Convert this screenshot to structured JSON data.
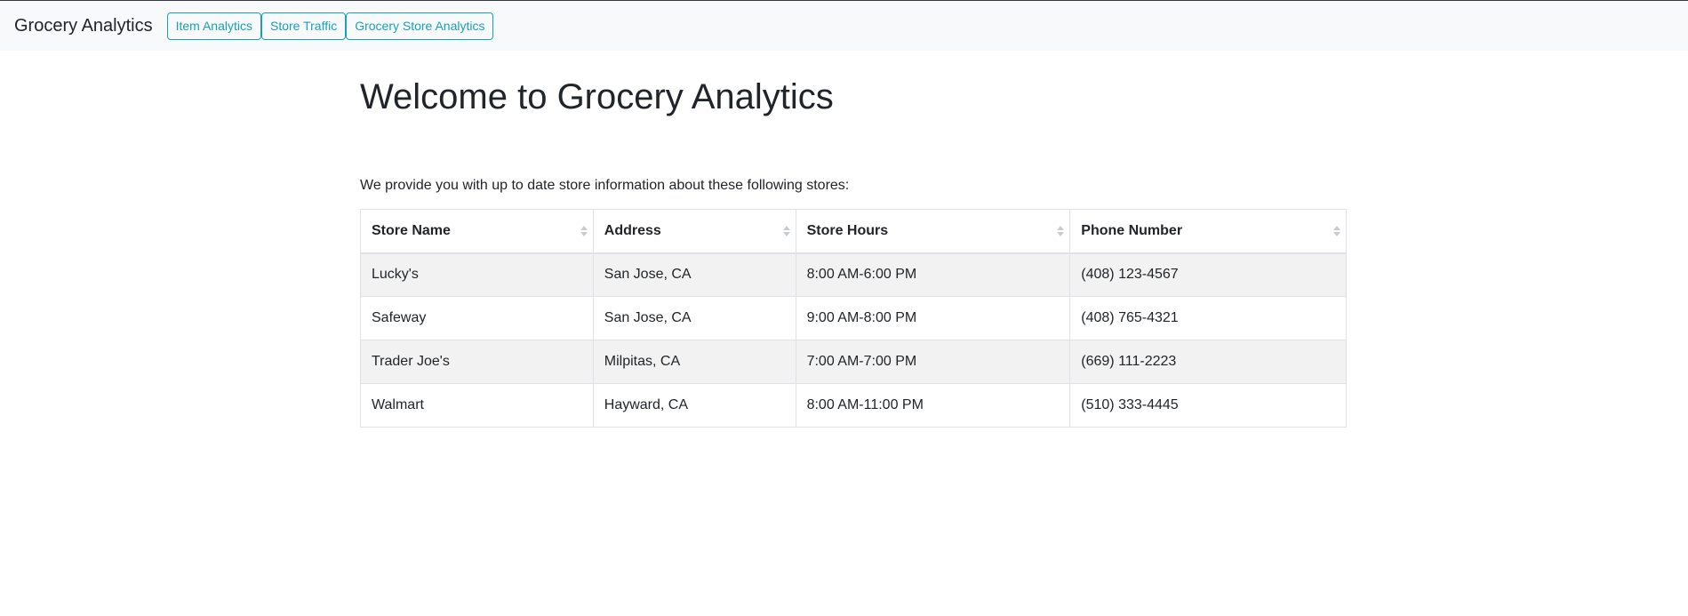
{
  "navbar": {
    "brand": "Grocery Analytics",
    "buttons": [
      {
        "label": "Item Analytics"
      },
      {
        "label": "Store Traffic"
      },
      {
        "label": "Grocery Store Analytics"
      }
    ]
  },
  "main": {
    "title": "Welcome to Grocery Analytics",
    "intro": "We provide you with up to date store information about these following stores:"
  },
  "table": {
    "headers": [
      "Store Name",
      "Address",
      "Store Hours",
      "Phone Number"
    ],
    "rows": [
      [
        "Lucky's",
        "San Jose, CA",
        "8:00 AM-6:00 PM",
        "(408) 123-4567"
      ],
      [
        "Safeway",
        "San Jose, CA",
        "9:00 AM-8:00 PM",
        "(408) 765-4321"
      ],
      [
        "Trader Joe's",
        "Milpitas, CA",
        "7:00 AM-7:00 PM",
        "(669) 111-2223"
      ],
      [
        "Walmart",
        "Hayward, CA",
        "8:00 AM-11:00 PM",
        "(510) 333-4445"
      ]
    ]
  },
  "colors": {
    "navbar_bg": "#f8f9fa",
    "accent": "#17a2b8",
    "stripe": "#f2f2f2",
    "border": "#dee2e6"
  },
  "icons": {
    "sort": "sort-arrows-icon"
  }
}
